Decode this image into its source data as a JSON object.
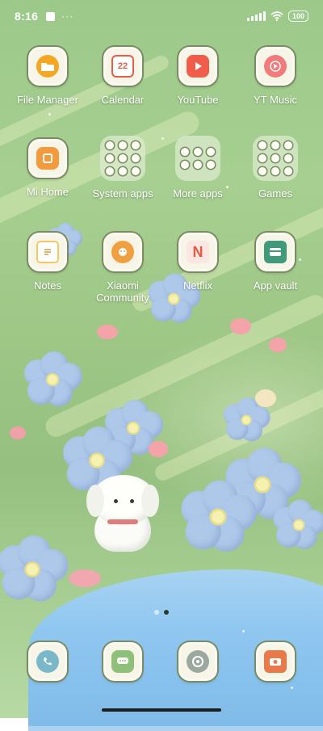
{
  "status_bar": {
    "time": "8:16",
    "extra": "···",
    "battery": "100"
  },
  "apps": [
    {
      "label": "File Manager",
      "icon": "folder-icon",
      "color": "#f5a623"
    },
    {
      "label": "Calendar",
      "icon": "calendar-icon",
      "color": "#e85d4a",
      "date": "22"
    },
    {
      "label": "YouTube",
      "icon": "play-icon",
      "color": "#f05d4a"
    },
    {
      "label": "YT Music",
      "icon": "music-play-icon",
      "color": "#f27a7a"
    },
    {
      "label": "Mi Home",
      "icon": "mi-home-icon",
      "color": "#f39a3c"
    },
    {
      "label": "System apps",
      "icon": "folder-grid-icon",
      "folder": true
    },
    {
      "label": "More apps",
      "icon": "folder-grid-icon",
      "folder": true
    },
    {
      "label": "Games",
      "icon": "folder-grid-icon",
      "folder": true
    },
    {
      "label": "Notes",
      "icon": "notes-icon",
      "color": "#f0c960"
    },
    {
      "label": "Xiaomi Community",
      "icon": "community-icon",
      "color": "#f0a040"
    },
    {
      "label": "Netflix",
      "icon": "netflix-icon",
      "color": "#e8583f",
      "glyph": "N"
    },
    {
      "label": "App vault",
      "icon": "app-vault-icon",
      "color": "#3f9a7a"
    }
  ],
  "dock": [
    {
      "name": "phone",
      "icon": "phone-icon",
      "color": "#7ab8c9"
    },
    {
      "name": "messages",
      "icon": "messages-icon",
      "color": "#8fc07a"
    },
    {
      "name": "browser",
      "icon": "browser-icon",
      "color": "#9aa8a0"
    },
    {
      "name": "camera",
      "icon": "camera-icon",
      "color": "#e87a4a"
    }
  ],
  "pager": {
    "pages": 2,
    "active": 2
  }
}
